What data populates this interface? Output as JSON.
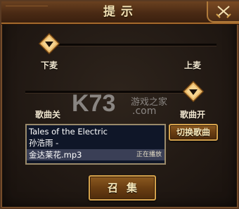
{
  "dialog": {
    "title": "提示",
    "close_icon": "crossed-swords-icon"
  },
  "mic_slider": {
    "left_label": "下麦",
    "right_label": "上麦",
    "level": 0.0
  },
  "music_slider": {
    "left_label": "歌曲关",
    "right_label": "歌曲开",
    "level": 1.0
  },
  "song": {
    "line1": "Tales of the Electric",
    "line2": "孙浩雨 -",
    "line3": "金达莱花.mp3",
    "status": "正在播放"
  },
  "buttons": {
    "switch_song": "切换歌曲",
    "summon": "召集"
  },
  "watermark": {
    "brand": "K73",
    "text": "游戏之家",
    "domain": ".com"
  },
  "colors": {
    "accent_gold": "#d4a24c",
    "title_text": "#f4e2b4",
    "song_box_bg": "#0f1628"
  }
}
